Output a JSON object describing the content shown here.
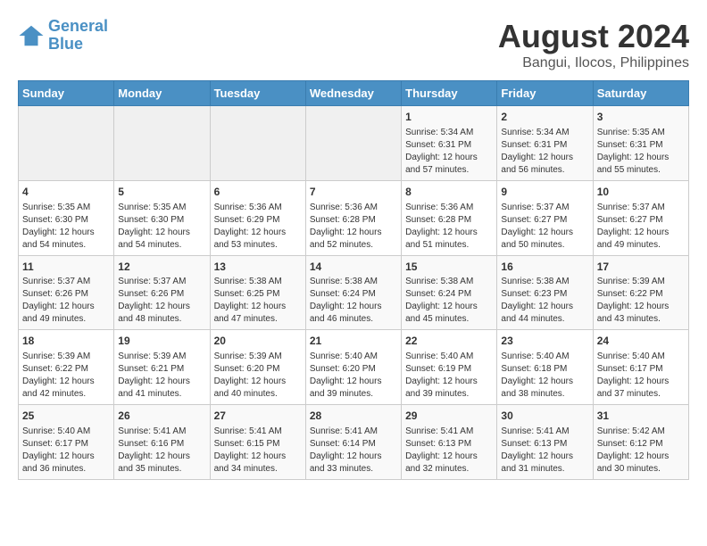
{
  "header": {
    "logo_line1": "General",
    "logo_line2": "Blue",
    "title": "August 2024",
    "subtitle": "Bangui, Ilocos, Philippines"
  },
  "days_of_week": [
    "Sunday",
    "Monday",
    "Tuesday",
    "Wednesday",
    "Thursday",
    "Friday",
    "Saturday"
  ],
  "weeks": [
    [
      {
        "day": "",
        "info": ""
      },
      {
        "day": "",
        "info": ""
      },
      {
        "day": "",
        "info": ""
      },
      {
        "day": "",
        "info": ""
      },
      {
        "day": "1",
        "info": "Sunrise: 5:34 AM\nSunset: 6:31 PM\nDaylight: 12 hours and 57 minutes."
      },
      {
        "day": "2",
        "info": "Sunrise: 5:34 AM\nSunset: 6:31 PM\nDaylight: 12 hours and 56 minutes."
      },
      {
        "day": "3",
        "info": "Sunrise: 5:35 AM\nSunset: 6:31 PM\nDaylight: 12 hours and 55 minutes."
      }
    ],
    [
      {
        "day": "4",
        "info": "Sunrise: 5:35 AM\nSunset: 6:30 PM\nDaylight: 12 hours and 54 minutes."
      },
      {
        "day": "5",
        "info": "Sunrise: 5:35 AM\nSunset: 6:30 PM\nDaylight: 12 hours and 54 minutes."
      },
      {
        "day": "6",
        "info": "Sunrise: 5:36 AM\nSunset: 6:29 PM\nDaylight: 12 hours and 53 minutes."
      },
      {
        "day": "7",
        "info": "Sunrise: 5:36 AM\nSunset: 6:28 PM\nDaylight: 12 hours and 52 minutes."
      },
      {
        "day": "8",
        "info": "Sunrise: 5:36 AM\nSunset: 6:28 PM\nDaylight: 12 hours and 51 minutes."
      },
      {
        "day": "9",
        "info": "Sunrise: 5:37 AM\nSunset: 6:27 PM\nDaylight: 12 hours and 50 minutes."
      },
      {
        "day": "10",
        "info": "Sunrise: 5:37 AM\nSunset: 6:27 PM\nDaylight: 12 hours and 49 minutes."
      }
    ],
    [
      {
        "day": "11",
        "info": "Sunrise: 5:37 AM\nSunset: 6:26 PM\nDaylight: 12 hours and 49 minutes."
      },
      {
        "day": "12",
        "info": "Sunrise: 5:37 AM\nSunset: 6:26 PM\nDaylight: 12 hours and 48 minutes."
      },
      {
        "day": "13",
        "info": "Sunrise: 5:38 AM\nSunset: 6:25 PM\nDaylight: 12 hours and 47 minutes."
      },
      {
        "day": "14",
        "info": "Sunrise: 5:38 AM\nSunset: 6:24 PM\nDaylight: 12 hours and 46 minutes."
      },
      {
        "day": "15",
        "info": "Sunrise: 5:38 AM\nSunset: 6:24 PM\nDaylight: 12 hours and 45 minutes."
      },
      {
        "day": "16",
        "info": "Sunrise: 5:38 AM\nSunset: 6:23 PM\nDaylight: 12 hours and 44 minutes."
      },
      {
        "day": "17",
        "info": "Sunrise: 5:39 AM\nSunset: 6:22 PM\nDaylight: 12 hours and 43 minutes."
      }
    ],
    [
      {
        "day": "18",
        "info": "Sunrise: 5:39 AM\nSunset: 6:22 PM\nDaylight: 12 hours and 42 minutes."
      },
      {
        "day": "19",
        "info": "Sunrise: 5:39 AM\nSunset: 6:21 PM\nDaylight: 12 hours and 41 minutes."
      },
      {
        "day": "20",
        "info": "Sunrise: 5:39 AM\nSunset: 6:20 PM\nDaylight: 12 hours and 40 minutes."
      },
      {
        "day": "21",
        "info": "Sunrise: 5:40 AM\nSunset: 6:20 PM\nDaylight: 12 hours and 39 minutes."
      },
      {
        "day": "22",
        "info": "Sunrise: 5:40 AM\nSunset: 6:19 PM\nDaylight: 12 hours and 39 minutes."
      },
      {
        "day": "23",
        "info": "Sunrise: 5:40 AM\nSunset: 6:18 PM\nDaylight: 12 hours and 38 minutes."
      },
      {
        "day": "24",
        "info": "Sunrise: 5:40 AM\nSunset: 6:17 PM\nDaylight: 12 hours and 37 minutes."
      }
    ],
    [
      {
        "day": "25",
        "info": "Sunrise: 5:40 AM\nSunset: 6:17 PM\nDaylight: 12 hours and 36 minutes."
      },
      {
        "day": "26",
        "info": "Sunrise: 5:41 AM\nSunset: 6:16 PM\nDaylight: 12 hours and 35 minutes."
      },
      {
        "day": "27",
        "info": "Sunrise: 5:41 AM\nSunset: 6:15 PM\nDaylight: 12 hours and 34 minutes."
      },
      {
        "day": "28",
        "info": "Sunrise: 5:41 AM\nSunset: 6:14 PM\nDaylight: 12 hours and 33 minutes."
      },
      {
        "day": "29",
        "info": "Sunrise: 5:41 AM\nSunset: 6:13 PM\nDaylight: 12 hours and 32 minutes."
      },
      {
        "day": "30",
        "info": "Sunrise: 5:41 AM\nSunset: 6:13 PM\nDaylight: 12 hours and 31 minutes."
      },
      {
        "day": "31",
        "info": "Sunrise: 5:42 AM\nSunset: 6:12 PM\nDaylight: 12 hours and 30 minutes."
      }
    ]
  ]
}
